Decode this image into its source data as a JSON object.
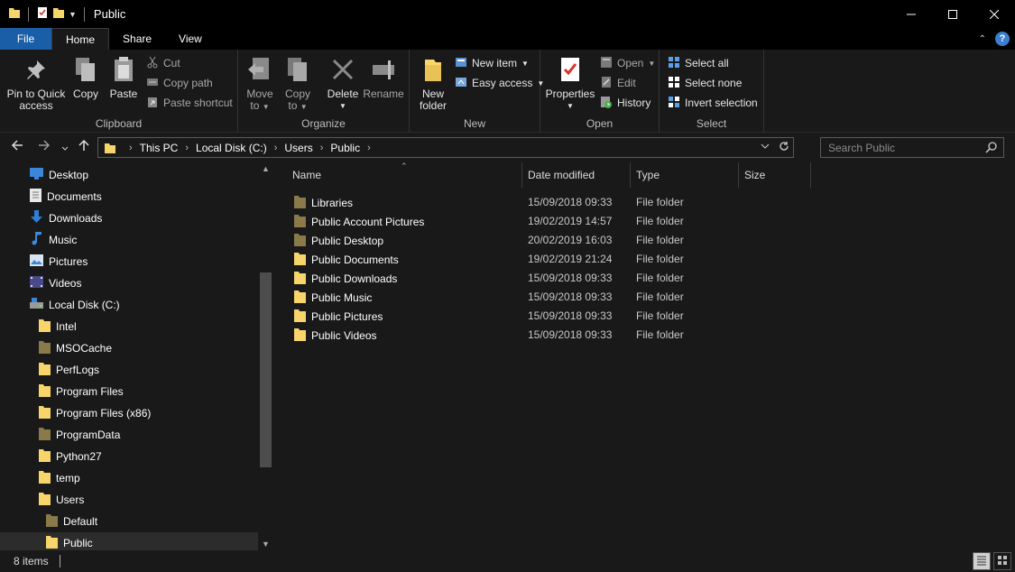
{
  "window": {
    "title": "Public"
  },
  "tabs": [
    "File",
    "Home",
    "Share",
    "View"
  ],
  "ribbon": {
    "clipboard": {
      "label": "Clipboard",
      "pin_line1": "Pin to Quick",
      "pin_line2": "access",
      "copy": "Copy",
      "paste": "Paste",
      "cut": "Cut",
      "copy_path": "Copy path",
      "paste_shortcut": "Paste shortcut"
    },
    "organize": {
      "label": "Organize",
      "move_line1": "Move",
      "move_line2": "to",
      "copy_line1": "Copy",
      "copy_line2": "to",
      "delete": "Delete",
      "rename": "Rename"
    },
    "new": {
      "label": "New",
      "folder_line1": "New",
      "folder_line2": "folder",
      "new_item": "New item",
      "easy_access": "Easy access"
    },
    "open": {
      "label": "Open",
      "properties": "Properties",
      "open": "Open",
      "edit": "Edit",
      "history": "History"
    },
    "select": {
      "label": "Select",
      "select_all": "Select all",
      "select_none": "Select none",
      "invert": "Invert selection"
    }
  },
  "address": {
    "crumbs": [
      "This PC",
      "Local Disk (C:)",
      "Users",
      "Public"
    ]
  },
  "search": {
    "placeholder": "Search Public"
  },
  "nav": {
    "items": [
      {
        "label": "Desktop",
        "icon": "desktop-icon"
      },
      {
        "label": "Documents",
        "icon": "documents-icon"
      },
      {
        "label": "Downloads",
        "icon": "downloads-icon"
      },
      {
        "label": "Music",
        "icon": "music-icon"
      },
      {
        "label": "Pictures",
        "icon": "pictures-icon"
      },
      {
        "label": "Videos",
        "icon": "videos-icon"
      },
      {
        "label": "Local Disk (C:)",
        "icon": "drive-icon"
      },
      {
        "label": "Intel",
        "icon": "folder-icon"
      },
      {
        "label": "MSOCache",
        "icon": "folder-icon"
      },
      {
        "label": "PerfLogs",
        "icon": "folder-icon"
      },
      {
        "label": "Program Files",
        "icon": "folder-icon"
      },
      {
        "label": "Program Files (x86)",
        "icon": "folder-icon"
      },
      {
        "label": "ProgramData",
        "icon": "folder-icon"
      },
      {
        "label": "Python27",
        "icon": "folder-icon"
      },
      {
        "label": "temp",
        "icon": "folder-icon"
      },
      {
        "label": "Users",
        "icon": "folder-icon"
      },
      {
        "label": "Default",
        "icon": "folder-icon"
      },
      {
        "label": "Public",
        "icon": "folder-icon"
      }
    ]
  },
  "columns": {
    "name": "Name",
    "date": "Date modified",
    "type": "Type",
    "size": "Size"
  },
  "files": [
    {
      "name": "Libraries",
      "date": "15/09/2018 09:33",
      "type": "File folder"
    },
    {
      "name": "Public Account Pictures",
      "date": "19/02/2019 14:57",
      "type": "File folder"
    },
    {
      "name": "Public Desktop",
      "date": "20/02/2019 16:03",
      "type": "File folder"
    },
    {
      "name": "Public Documents",
      "date": "19/02/2019 21:24",
      "type": "File folder"
    },
    {
      "name": "Public Downloads",
      "date": "15/09/2018 09:33",
      "type": "File folder"
    },
    {
      "name": "Public Music",
      "date": "15/09/2018 09:33",
      "type": "File folder"
    },
    {
      "name": "Public Pictures",
      "date": "15/09/2018 09:33",
      "type": "File folder"
    },
    {
      "name": "Public Videos",
      "date": "15/09/2018 09:33",
      "type": "File folder"
    }
  ],
  "status": {
    "count": "8 items"
  },
  "colors": {
    "accent": "#1a5ea8",
    "folder": "#f7d56b",
    "folder_dim": "#8a7a4a",
    "background": "#191919"
  }
}
